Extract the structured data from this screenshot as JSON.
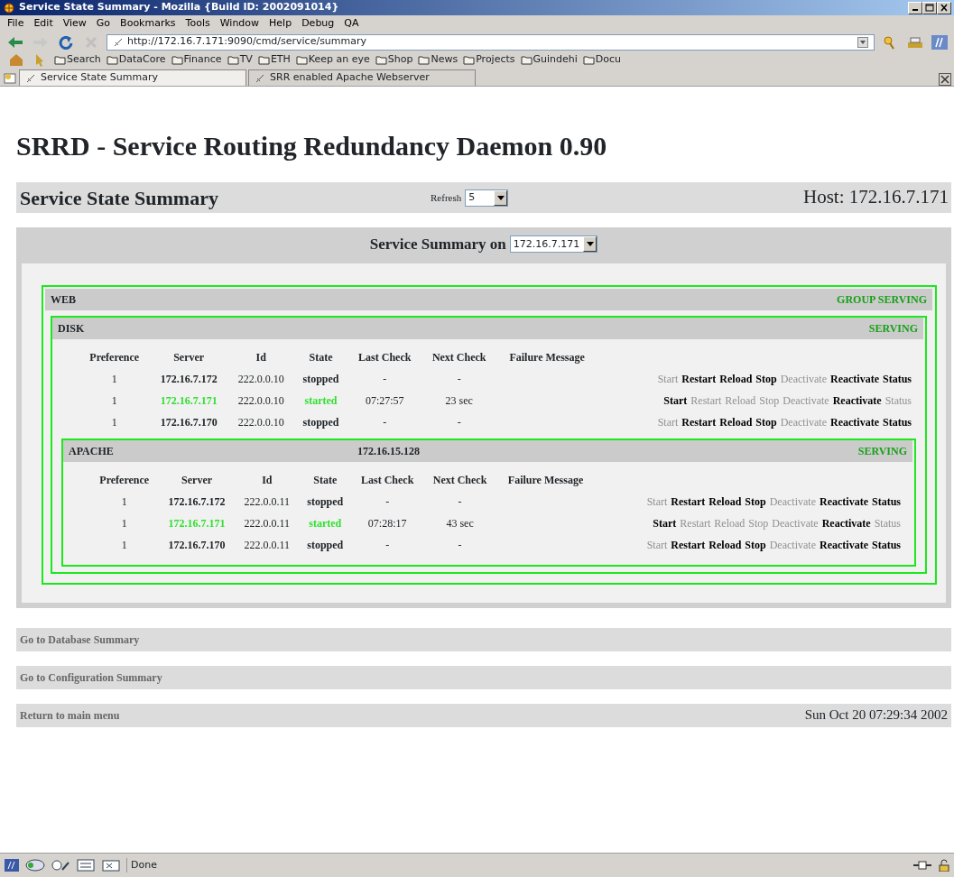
{
  "window": {
    "title": "Service State Summary - Mozilla {Build ID: 2002091014}"
  },
  "menu": [
    "File",
    "Edit",
    "View",
    "Go",
    "Bookmarks",
    "Tools",
    "Window",
    "Help",
    "Debug",
    "QA"
  ],
  "address": {
    "url": "http://172.16.7.171:9090/cmd/service/summary"
  },
  "bookmarks": [
    "Search",
    "DataCore",
    "Finance",
    "TV",
    "ETH",
    "Keep an eye",
    "Shop",
    "News",
    "Projects",
    "Guindehi",
    "Docu"
  ],
  "tabs": [
    {
      "label": "Service State Summary",
      "selected": true
    },
    {
      "label": "SRR enabled Apache Webserver",
      "selected": false
    }
  ],
  "page": {
    "heading": "SRRD - Service Routing Redundancy Daemon 0.90",
    "subheader": {
      "title": "Service State Summary",
      "refresh_label": "Refresh",
      "refresh_value": "5",
      "host": "Host: 172.16.7.171"
    },
    "summary": {
      "label": "Service Summary on",
      "host_value": "172.16.7.171"
    },
    "groups": [
      {
        "name": "WEB",
        "status": "GROUP SERVING",
        "services": [
          {
            "name": "DISK",
            "status": "SERVING",
            "columns": [
              "Preference",
              "Server",
              "Id",
              "State",
              "Last Check",
              "Next Check",
              "Failure Message"
            ],
            "rows": [
              {
                "preference": "1",
                "server": "172.16.7.172",
                "id": "222.0.0.10",
                "state": "stopped",
                "active": false,
                "last_check": "-",
                "next_check": "-",
                "actions": [
                  {
                    "label": "Start",
                    "enabled": false
                  },
                  {
                    "label": "Restart",
                    "enabled": true
                  },
                  {
                    "label": "Reload",
                    "enabled": true
                  },
                  {
                    "label": "Stop",
                    "enabled": true
                  },
                  {
                    "label": "Deactivate",
                    "enabled": false
                  },
                  {
                    "label": "Reactivate",
                    "enabled": true
                  },
                  {
                    "label": "Status",
                    "enabled": true
                  }
                ]
              },
              {
                "preference": "1",
                "server": "172.16.7.171",
                "id": "222.0.0.10",
                "state": "started",
                "active": true,
                "last_check": "07:27:57",
                "next_check": "23 sec",
                "actions": [
                  {
                    "label": "Start",
                    "enabled": true
                  },
                  {
                    "label": "Restart",
                    "enabled": false
                  },
                  {
                    "label": "Reload",
                    "enabled": false
                  },
                  {
                    "label": "Stop",
                    "enabled": false
                  },
                  {
                    "label": "Deactivate",
                    "enabled": false
                  },
                  {
                    "label": "Reactivate",
                    "enabled": true
                  },
                  {
                    "label": "Status",
                    "enabled": false
                  }
                ]
              },
              {
                "preference": "1",
                "server": "172.16.7.170",
                "id": "222.0.0.10",
                "state": "stopped",
                "active": false,
                "last_check": "-",
                "next_check": "-",
                "actions": [
                  {
                    "label": "Start",
                    "enabled": false
                  },
                  {
                    "label": "Restart",
                    "enabled": true
                  },
                  {
                    "label": "Reload",
                    "enabled": true
                  },
                  {
                    "label": "Stop",
                    "enabled": true
                  },
                  {
                    "label": "Deactivate",
                    "enabled": false
                  },
                  {
                    "label": "Reactivate",
                    "enabled": true
                  },
                  {
                    "label": "Status",
                    "enabled": true
                  }
                ]
              }
            ],
            "children": [
              {
                "name": "APACHE",
                "address": "172.16.15.128",
                "status": "SERVING",
                "columns": [
                  "Preference",
                  "Server",
                  "Id",
                  "State",
                  "Last Check",
                  "Next Check",
                  "Failure Message"
                ],
                "rows": [
                  {
                    "preference": "1",
                    "server": "172.16.7.172",
                    "id": "222.0.0.11",
                    "state": "stopped",
                    "active": false,
                    "last_check": "-",
                    "next_check": "-",
                    "actions": [
                      {
                        "label": "Start",
                        "enabled": false
                      },
                      {
                        "label": "Restart",
                        "enabled": true
                      },
                      {
                        "label": "Reload",
                        "enabled": true
                      },
                      {
                        "label": "Stop",
                        "enabled": true
                      },
                      {
                        "label": "Deactivate",
                        "enabled": false
                      },
                      {
                        "label": "Reactivate",
                        "enabled": true
                      },
                      {
                        "label": "Status",
                        "enabled": true
                      }
                    ]
                  },
                  {
                    "preference": "1",
                    "server": "172.16.7.171",
                    "id": "222.0.0.11",
                    "state": "started",
                    "active": true,
                    "last_check": "07:28:17",
                    "next_check": "43 sec",
                    "actions": [
                      {
                        "label": "Start",
                        "enabled": true
                      },
                      {
                        "label": "Restart",
                        "enabled": false
                      },
                      {
                        "label": "Reload",
                        "enabled": false
                      },
                      {
                        "label": "Stop",
                        "enabled": false
                      },
                      {
                        "label": "Deactivate",
                        "enabled": false
                      },
                      {
                        "label": "Reactivate",
                        "enabled": true
                      },
                      {
                        "label": "Status",
                        "enabled": false
                      }
                    ]
                  },
                  {
                    "preference": "1",
                    "server": "172.16.7.170",
                    "id": "222.0.0.11",
                    "state": "stopped",
                    "active": false,
                    "last_check": "-",
                    "next_check": "-",
                    "actions": [
                      {
                        "label": "Start",
                        "enabled": false
                      },
                      {
                        "label": "Restart",
                        "enabled": true
                      },
                      {
                        "label": "Reload",
                        "enabled": true
                      },
                      {
                        "label": "Stop",
                        "enabled": true
                      },
                      {
                        "label": "Deactivate",
                        "enabled": false
                      },
                      {
                        "label": "Reactivate",
                        "enabled": true
                      },
                      {
                        "label": "Status",
                        "enabled": true
                      }
                    ]
                  }
                ]
              }
            ]
          }
        ]
      }
    ],
    "links": [
      "Go to Database Summary",
      "Go to Configuration Summary",
      "Return to main menu"
    ],
    "date": "Sun Oct 20 07:29:34 2002"
  },
  "status_bar": {
    "text": "Done"
  }
}
